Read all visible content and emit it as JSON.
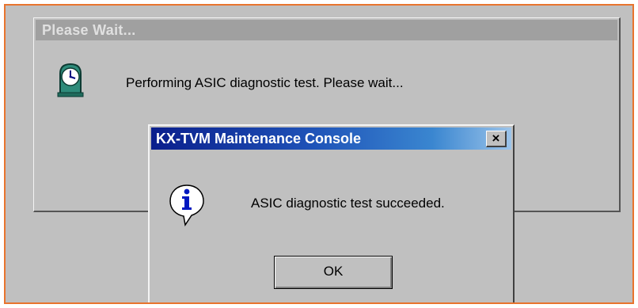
{
  "wait_dialog": {
    "title": "Please Wait...",
    "message": "Performing ASIC diagnostic test. Please wait...",
    "icon": "clock-icon"
  },
  "message_box": {
    "title": "KX-TVM Maintenance Console",
    "close_label": "×",
    "message": "ASIC diagnostic test succeeded.",
    "icon": "info-icon",
    "ok_label": "OK"
  },
  "colors": {
    "window_bg": "#c0c0c0",
    "inactive_titlebar": "#a0a0a0",
    "active_titlebar_start": "#0a1e8c",
    "active_titlebar_end": "#9cc4ea",
    "frame_border": "#e8742e"
  }
}
